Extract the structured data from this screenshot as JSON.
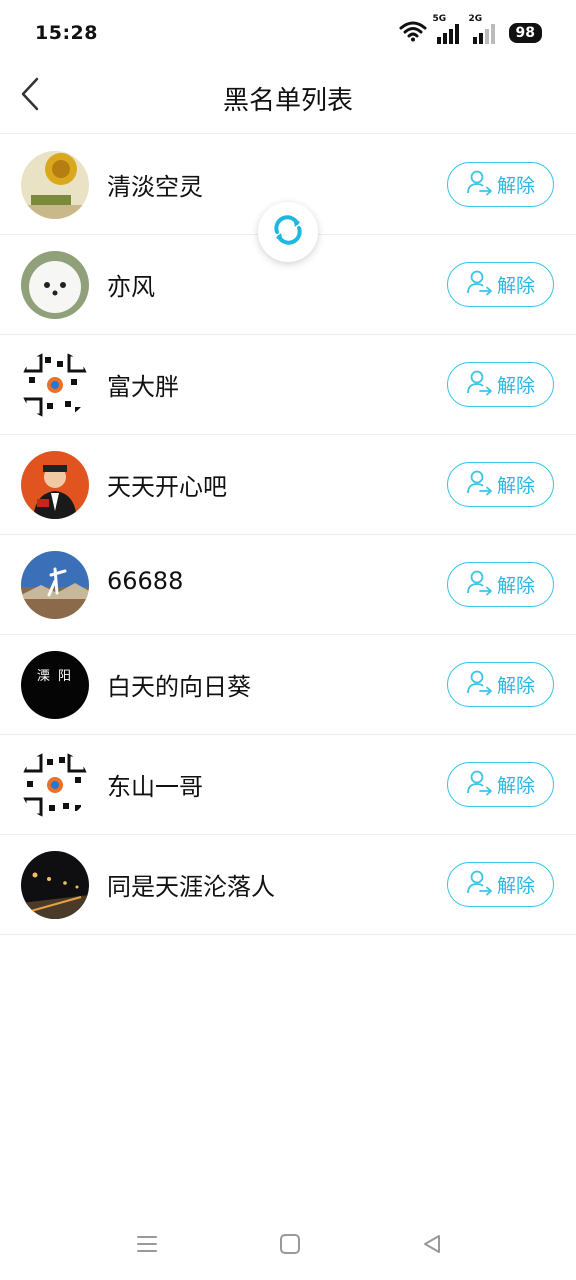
{
  "status": {
    "time": "15:28",
    "net1": "5G",
    "net2": "2G",
    "battery": "98"
  },
  "header": {
    "title": "黑名单列表",
    "back_icon": "chevron-left-icon"
  },
  "colors": {
    "accent": "#3ec5e6",
    "divider": "#ececec"
  },
  "blocked": {
    "unblock_icon": "user-arrow-icon",
    "items": [
      {
        "name": "清淡空灵",
        "button": "解除"
      },
      {
        "name": "亦风",
        "button": "解除"
      },
      {
        "name": "富大胖",
        "button": "解除"
      },
      {
        "name": "天天开心吧",
        "button": "解除"
      },
      {
        "name": "66688",
        "button": "解除"
      },
      {
        "name": "白天的向日葵",
        "button": "解除",
        "avatar_text": "溧 阳"
      },
      {
        "name": "东山一哥",
        "button": "解除"
      },
      {
        "name": "同是天涯沦落人",
        "button": "解除"
      }
    ]
  },
  "refresh": {
    "icon": "refresh-icon"
  },
  "system_nav": {
    "menu_icon": "menu-icon",
    "home_icon": "home-icon",
    "back_icon": "back-triangle-icon"
  }
}
